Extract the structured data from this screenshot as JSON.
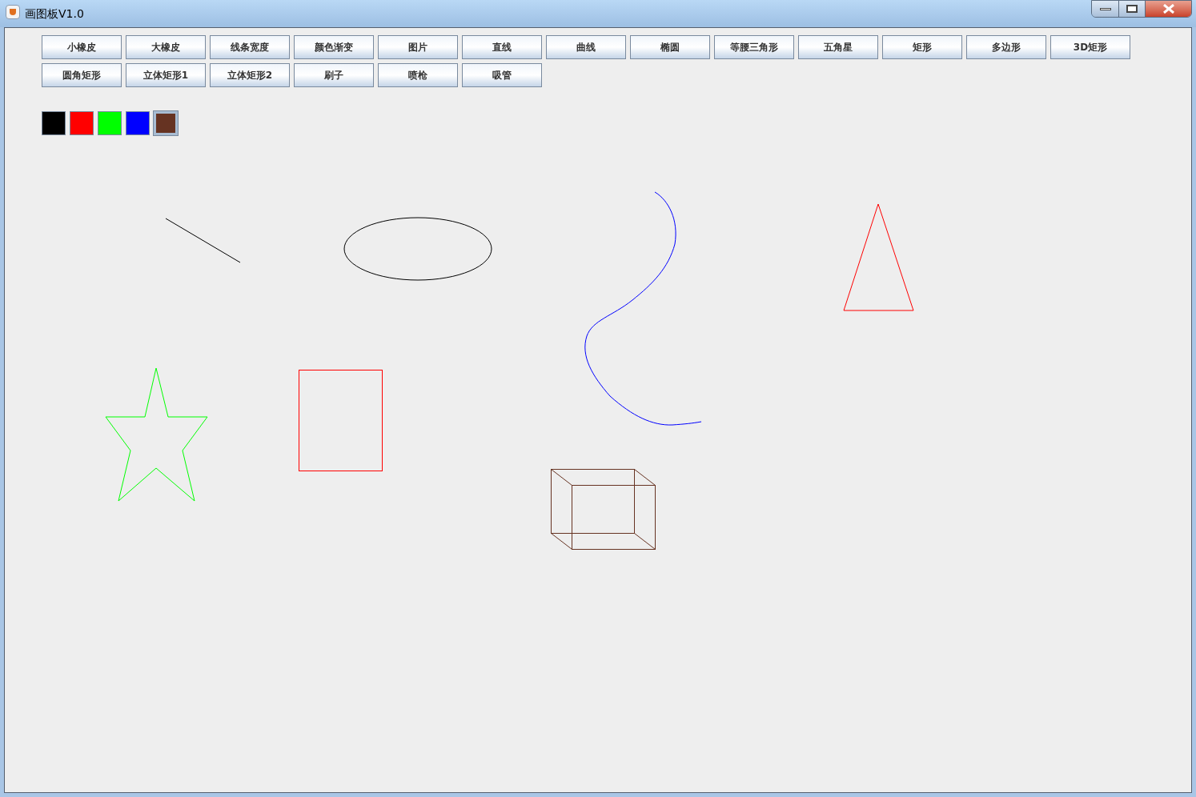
{
  "window": {
    "title": "画图板V1.0"
  },
  "toolbar": {
    "buttons": [
      {
        "label": "小橡皮"
      },
      {
        "label": "大橡皮"
      },
      {
        "label": "线条宽度"
      },
      {
        "label": "颜色渐变"
      },
      {
        "label": "图片"
      },
      {
        "label": "直线"
      },
      {
        "label": "曲线"
      },
      {
        "label": "椭圆"
      },
      {
        "label": "等腰三角形"
      },
      {
        "label": "五角星"
      },
      {
        "label": "矩形"
      },
      {
        "label": "多边形"
      },
      {
        "label": "3D矩形"
      },
      {
        "label": "圆角矩形"
      },
      {
        "label": "立体矩形1"
      },
      {
        "label": "立体矩形2"
      },
      {
        "label": "刷子"
      },
      {
        "label": "喷枪"
      },
      {
        "label": "吸管"
      }
    ]
  },
  "palette": [
    {
      "color": "#000000",
      "selected": false
    },
    {
      "color": "#ff0000",
      "selected": false
    },
    {
      "color": "#00ff00",
      "selected": false
    },
    {
      "color": "#0000ff",
      "selected": false
    },
    {
      "color": "#663322",
      "selected": true
    }
  ]
}
